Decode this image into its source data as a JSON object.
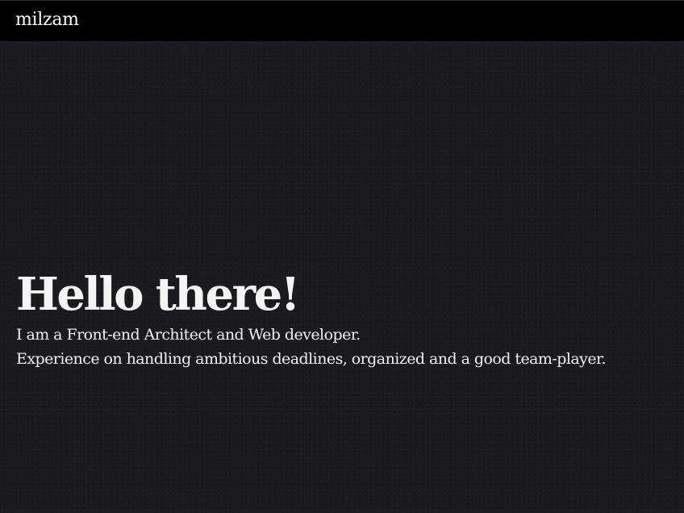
{
  "header": {
    "brand": "milzam"
  },
  "hero": {
    "title": "Hello there!",
    "lines": [
      "I am a Front-end Architect and Web developer.",
      "Experience on handling ambitious deadlines, organized and a good team-player."
    ]
  },
  "colors": {
    "header_bg": "#000000",
    "page_bg": "#1b1b1d",
    "text": "#f2f2f2"
  }
}
